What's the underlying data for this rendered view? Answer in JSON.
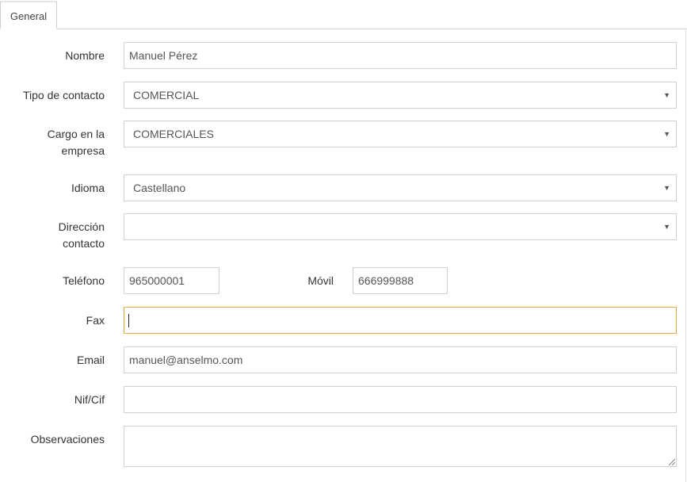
{
  "tabs": [
    {
      "label": "General"
    }
  ],
  "form": {
    "nombre": {
      "label": "Nombre",
      "value": "Manuel Pérez"
    },
    "tipo_contacto": {
      "label": "Tipo de contacto",
      "value": "COMERCIAL"
    },
    "cargo": {
      "label_line1": "Cargo en la",
      "label_line2": "empresa",
      "value": "COMERCIALES"
    },
    "idioma": {
      "label": "Idioma",
      "value": "Castellano"
    },
    "direccion": {
      "label_line1": "Dirección",
      "label_line2": "contacto",
      "value": ""
    },
    "telefono": {
      "label": "Teléfono",
      "value": "965000001"
    },
    "movil": {
      "label": "Móvil",
      "value": "666999888"
    },
    "fax": {
      "label": "Fax",
      "value": ""
    },
    "email": {
      "label": "Email",
      "value": "manuel@anselmo.com"
    },
    "nif": {
      "label": "Nif/Cif",
      "value": ""
    },
    "observaciones": {
      "label": "Observaciones",
      "value": ""
    }
  },
  "icons": {
    "dropdown": "chevron-down-icon",
    "caret_glyph": "▼"
  }
}
